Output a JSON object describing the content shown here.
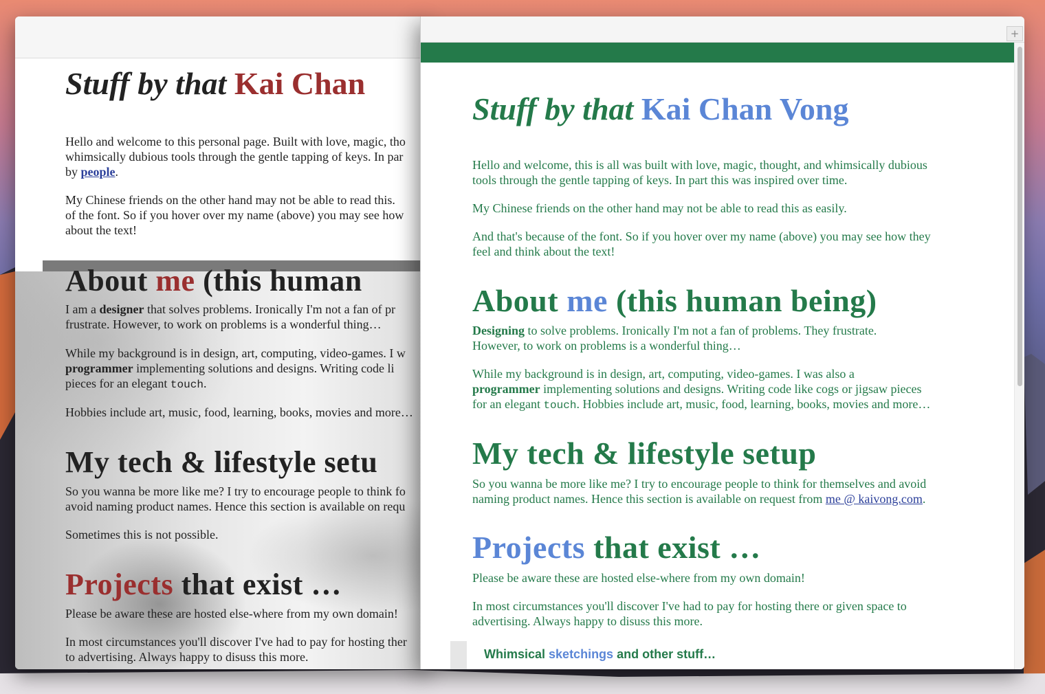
{
  "back_window": {
    "title_a": "Stuff by that ",
    "title_b": "Kai Chan",
    "intro_p1_a": "Hello and welcome to this personal page. Built with love, magic, tho",
    "intro_p1_b": "whimsically dubious tools through the gentle tapping of keys. In par",
    "intro_p1_c": "by ",
    "intro_link": "people",
    "intro_p1_d": ".",
    "intro_p2_a": "My Chinese friends on the other hand may not be able to read this.",
    "intro_p2_b": "of the font. So if you hover over my name (above) you may see how",
    "intro_p2_c": "about the text!",
    "about_a": "About ",
    "about_b": "me",
    "about_c": " (this human",
    "about_p1_a": "I am a ",
    "about_p1_b": "designer",
    "about_p1_c": " that solves problems. Ironically I'm not a fan of pr",
    "about_p1_d": "frustrate. However, to work on problems is a wonderful thing…",
    "about_p2_a": "While my background is in design, art, computing, video-games. I w",
    "about_p2_b": "programmer",
    "about_p2_c": " implementing solutions and designs. Writing code li",
    "about_p2_d": "pieces for an elegant ",
    "about_p2_e": "touch",
    "about_p2_f": ".",
    "about_p3": "Hobbies include art, music, food, learning, books, movies and more…",
    "tech_h": "My tech & lifestyle setu",
    "tech_p1_a": "So you wanna be more like me? I try to encourage people to think fo",
    "tech_p1_b": "avoid naming product names. Hence this section is available on requ",
    "tech_p2": "Sometimes this is not possible.",
    "proj_a": "Projects",
    "proj_b": " that exist …",
    "proj_p1": "Please be aware these are hosted else-where from my own domain!",
    "proj_p2_a": "In most circumstances you'll discover I've had to pay for hosting ther",
    "proj_p2_b": "to advertising. Always happy to disuss this more."
  },
  "front_window": {
    "new_tab": "+",
    "title_a": "Stuff by that ",
    "title_b": "Kai Chan Vong",
    "intro_p1_a": "Hello and welcome, this is all was built with love, magic, thought, and whimsically dubious",
    "intro_p1_b": "tools through the gentle tapping of keys. In part this was inspired over time.",
    "intro_p2": "My Chinese friends on the other hand may not be able to read this as easily.",
    "intro_p3_a": "And that's because of the font. So if you hover over my name (above) you may see how they",
    "intro_p3_b": "feel and think about the text!",
    "about_a": "About ",
    "about_b": "me",
    "about_c": " (this human being)",
    "about_p1_a": "Designing",
    "about_p1_b": " to solve problems. Ironically I'm not a fan of problems. They frustrate.",
    "about_p1_c": "However, to work on problems is a wonderful thing…",
    "about_p2_a": "While my background is in design, art, computing, video-games. I was also a",
    "about_p2_b": "programmer",
    "about_p2_c": " implementing solutions and designs. Writing code like cogs or jigsaw pieces",
    "about_p2_d": "for an elegant ",
    "about_p2_e": "touch",
    "about_p2_f": ". Hobbies include art, music, food, learning, books, movies and more…",
    "tech_h": "My tech & lifestyle setup",
    "tech_p1_a": "So you wanna be more like me? I try to encourage people to think for themselves and avoid",
    "tech_p1_b": "naming product names. Hence this section is available on request from ",
    "tech_link": "me @ kaivong.com",
    "tech_p1_c": ".",
    "proj_a": "Projects",
    "proj_b": " that exist …",
    "proj_p1": "Please be aware these are hosted else-where from my own domain!",
    "proj_p2_a": "In most circumstances you'll discover I've had to pay for hosting there or given space to",
    "proj_p2_b": "advertising. Always happy to disuss this more.",
    "sub_a": "Whimsical ",
    "sub_b": "sketchings",
    "sub_c": " and other stuff…"
  },
  "colors": {
    "back_accent": "#9a2f2f",
    "front_green": "#247a4a",
    "front_blue": "#5b86d6",
    "link": "#2b3f9a"
  }
}
